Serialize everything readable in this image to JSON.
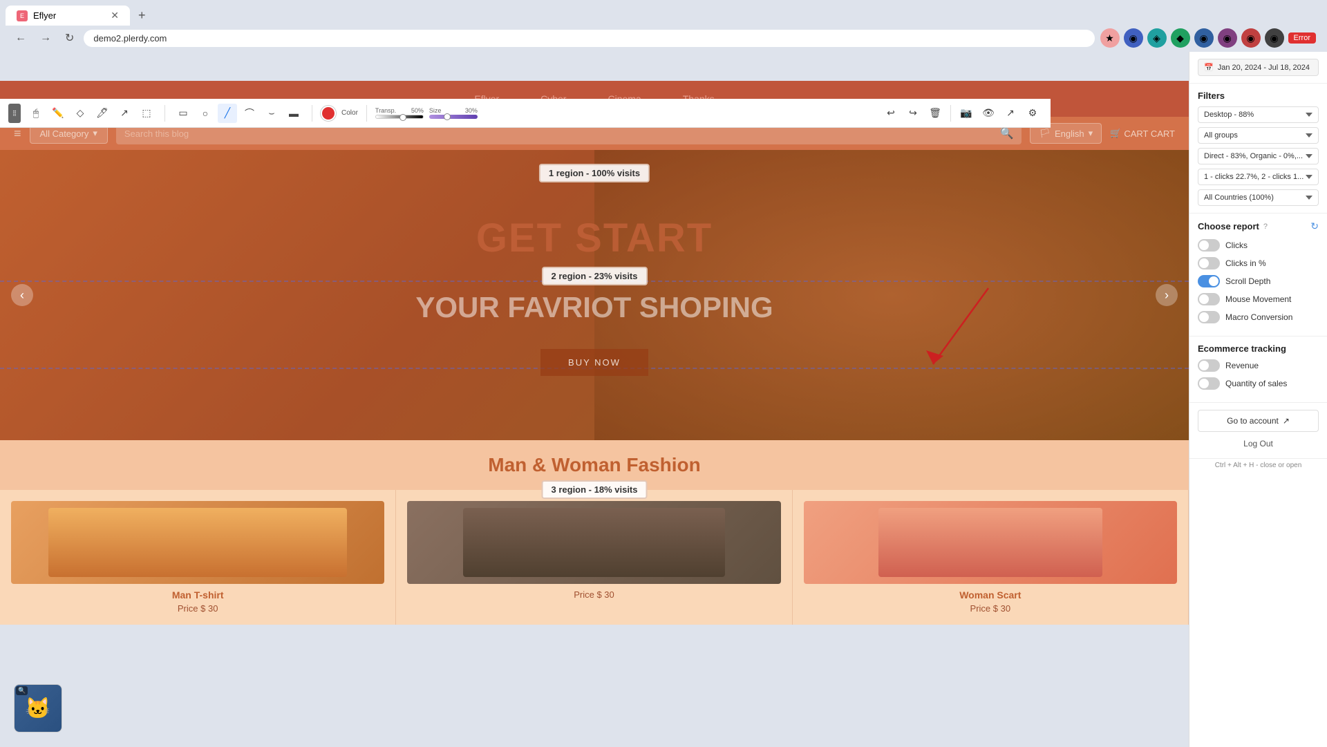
{
  "browser": {
    "tab_title": "Eflyer",
    "url": "demo2.plerdy.com",
    "error_badge": "Error"
  },
  "annotation_toolbar": {
    "tools": [
      "cursor",
      "pen",
      "shape",
      "highlighter",
      "line",
      "frame",
      "rect",
      "circle",
      "line-diag",
      "curve-left",
      "curve-right",
      "rect-rounded"
    ],
    "color_label": "Color",
    "transp_label": "Transp.",
    "transp_value": "50%",
    "size_label": "Size",
    "size_value": "30%"
  },
  "date_range": "Jan 20, 2024 - Jul 18, 2024",
  "filters": {
    "title": "Filters",
    "device": "Desktop - 88%",
    "groups": "All groups",
    "source": "Direct - 83%, Organic - 0%,...",
    "clicks_filter": "1 - clicks 22.7%, 2 - clicks 1...",
    "country": "All Countries (100%)"
  },
  "choose_report": {
    "title": "Choose report",
    "items": [
      {
        "label": "Clicks",
        "state": "off"
      },
      {
        "label": "Clicks in %",
        "state": "off"
      },
      {
        "label": "Scroll Depth",
        "state": "on"
      },
      {
        "label": "Mouse Movement",
        "state": "off"
      },
      {
        "label": "Macro Conversion",
        "state": "off"
      }
    ]
  },
  "ecommerce": {
    "title": "Ecommerce tracking",
    "items": [
      {
        "label": "Revenue",
        "state": "off"
      },
      {
        "label": "Quantity of sales",
        "state": "off"
      }
    ]
  },
  "go_to_account_label": "Go to account",
  "log_out_label": "Log Out",
  "hint": "Ctrl + Alt + H - close or open",
  "website": {
    "brand": "Eflyer",
    "nav_links": [
      "Eflyer",
      "Cyber",
      "Cinema",
      "Thanks"
    ],
    "category_placeholder": "All Category",
    "search_placeholder": "Search this blog",
    "language": "English",
    "cart_label": "CART CART",
    "hero_title": "GET START",
    "hero_subtitle": "YOUR FAVRIOT SHOPING",
    "hero_cta": "BUY NOW",
    "region_1": "1 region - 100% visits",
    "region_2": "2 region - 23% visits",
    "region_3": "3 region - 18% visits",
    "fashion_title": "Man & Woman Fashion",
    "products": [
      {
        "name": "Man T-shirt",
        "price": "Price $ 30"
      },
      {
        "name": "",
        "price": "Price $ 30"
      },
      {
        "name": "Woman Scart",
        "price": "Price $ 30"
      }
    ]
  }
}
